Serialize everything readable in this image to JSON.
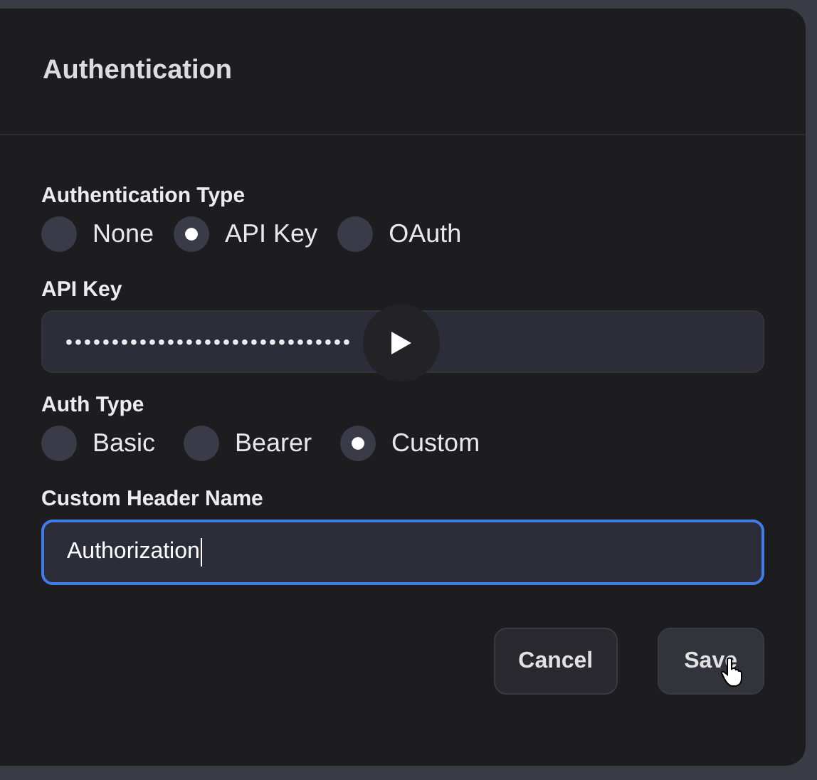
{
  "dialog": {
    "title": "Authentication"
  },
  "auth_type": {
    "label": "Authentication Type",
    "options": [
      {
        "label": "None",
        "selected": false
      },
      {
        "label": "API Key",
        "selected": true
      },
      {
        "label": "OAuth",
        "selected": false
      }
    ]
  },
  "api_key": {
    "label": "API Key",
    "value": "•••••••••••••••••••••••••••••••"
  },
  "auth_subtype": {
    "label": "Auth Type",
    "options": [
      {
        "label": "Basic",
        "selected": false
      },
      {
        "label": "Bearer",
        "selected": false
      },
      {
        "label": "Custom",
        "selected": true
      }
    ]
  },
  "header_name": {
    "label": "Custom Header Name",
    "value": "Authorization",
    "focused": true
  },
  "buttons": [
    {
      "label": "Cancel",
      "hovered": false
    },
    {
      "label": "Save",
      "hovered": true
    }
  ]
}
